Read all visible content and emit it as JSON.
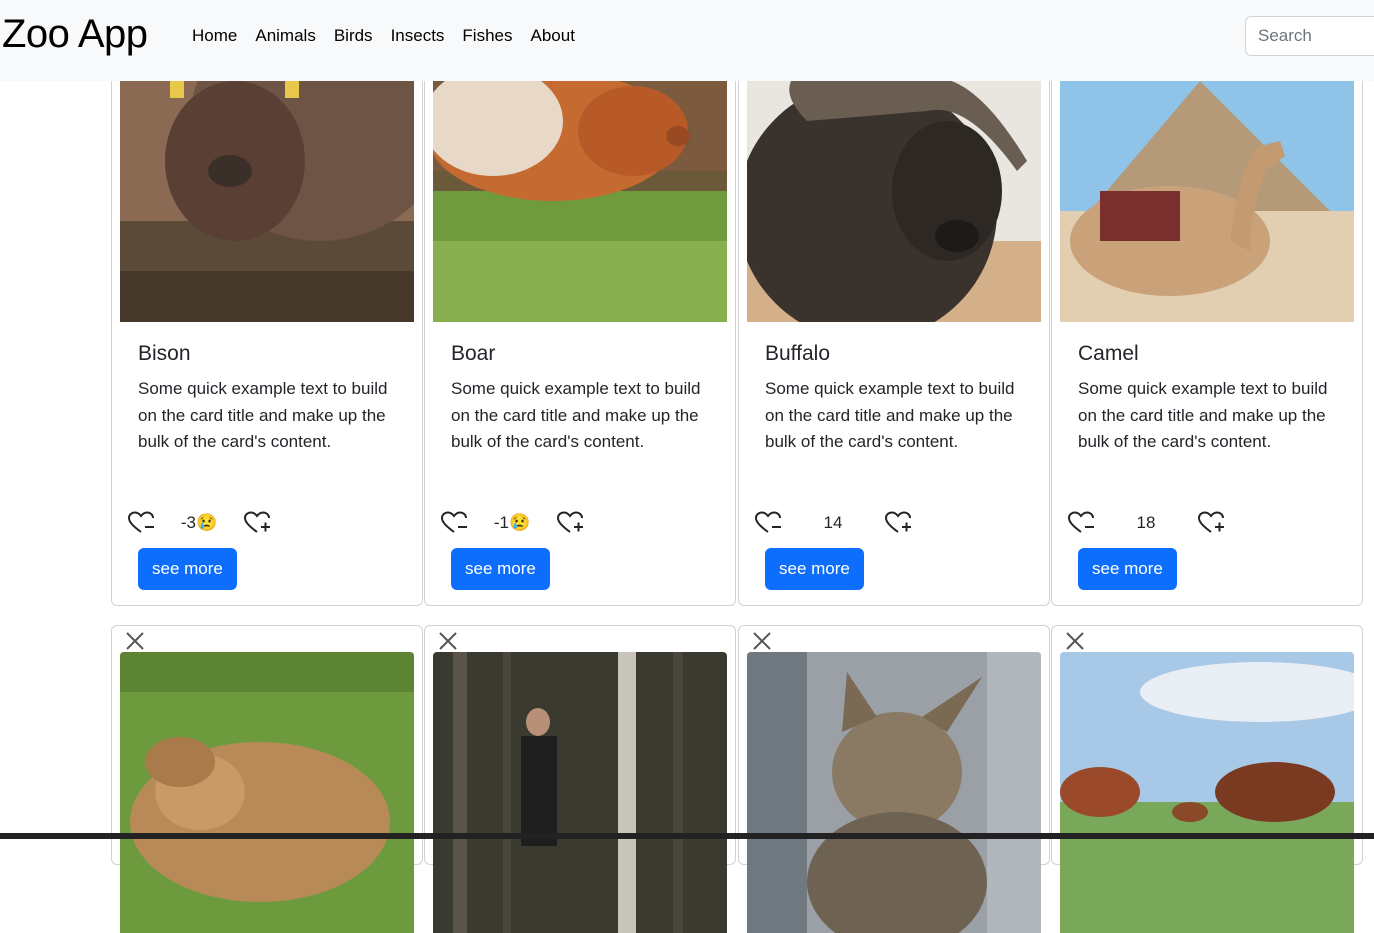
{
  "navbar": {
    "brand": "Zoo App",
    "links": [
      "Home",
      "Animals",
      "Birds",
      "Insects",
      "Fishes",
      "About"
    ],
    "search_placeholder": "Search"
  },
  "cards": [
    {
      "title": "Bison",
      "text": "Some quick example text to build on the card title and make up the bulk of the card's content.",
      "likes": "-3",
      "emoji": "😢",
      "button": "see more"
    },
    {
      "title": "Boar",
      "text": "Some quick example text to build on the card title and make up the bulk of the card's content.",
      "likes": "-1",
      "emoji": "😢",
      "button": "see more"
    },
    {
      "title": "Buffalo",
      "text": "Some quick example text to build on the card title and make up the bulk of the card's content.",
      "likes": "14",
      "emoji": "",
      "button": "see more"
    },
    {
      "title": "Camel",
      "text": "Some quick example text to build on the card title and make up the bulk of the card's content.",
      "likes": "18",
      "emoji": "",
      "button": "see more"
    }
  ],
  "second_row": [
    {
      "animal": "capybara"
    },
    {
      "animal": "person in forest"
    },
    {
      "animal": "kitten"
    },
    {
      "animal": "cattle"
    }
  ],
  "colors": {
    "primary": "#0d6efd",
    "navbar_bg": "#f8f9fa",
    "text": "#212529"
  }
}
